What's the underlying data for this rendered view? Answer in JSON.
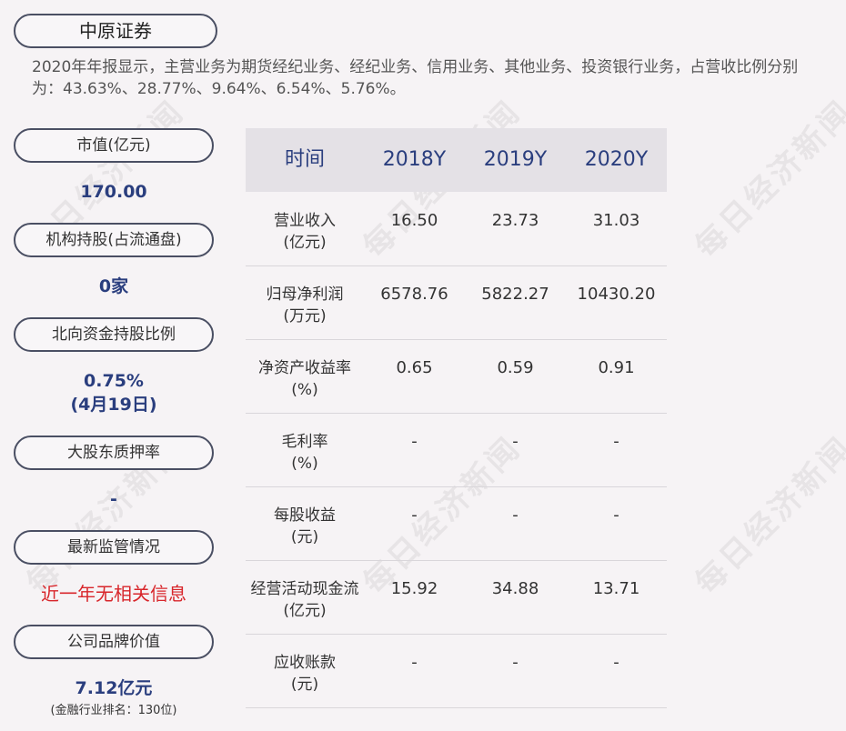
{
  "company": "中原证券",
  "intro": "2020年年报显示，主营业务为期货经纪业务、经纪业务、信用业务、其他业务、投资银行业务，占营收比例分别为：43.63%、28.77%、9.64%、6.54%、5.76%。",
  "sidebar": {
    "market_cap_label": "市值(亿元)",
    "market_cap_value": "170.00",
    "institution_label": "机构持股(占流通盘)",
    "institution_value": "0家",
    "northbound_label": "北向资金持股比例",
    "northbound_value": "0.75%",
    "northbound_date": "(4月19日)",
    "pledge_label": "大股东质押率",
    "pledge_value": "-",
    "regulation_label": "最新监管情况",
    "regulation_value": "近一年无相关信息",
    "brand_label": "公司品牌价值",
    "brand_value": "7.12亿元",
    "brand_rank": "(金融行业排名：130位)"
  },
  "table": {
    "header": [
      "时间",
      "2018Y",
      "2019Y",
      "2020Y"
    ],
    "rows": [
      {
        "label1": "营业收入",
        "label2": "(亿元)",
        "v2018": "16.50",
        "v2019": "23.73",
        "v2020": "31.03"
      },
      {
        "label1": "归母净利润",
        "label2": "(万元)",
        "v2018": "6578.76",
        "v2019": "5822.27",
        "v2020": "10430.20"
      },
      {
        "label1": "净资产收益率",
        "label2": "(%)",
        "v2018": "0.65",
        "v2019": "0.59",
        "v2020": "0.91"
      },
      {
        "label1": "毛利率",
        "label2": "(%)",
        "v2018": "-",
        "v2019": "-",
        "v2020": "-"
      },
      {
        "label1": "每股收益",
        "label2": "(元)",
        "v2018": "-",
        "v2019": "-",
        "v2020": "-"
      },
      {
        "label1": "经营活动现金流",
        "label2": "(亿元)",
        "v2018": "15.92",
        "v2019": "34.88",
        "v2020": "13.71"
      },
      {
        "label1": "应收账款",
        "label2": "(元)",
        "v2018": "-",
        "v2019": "-",
        "v2020": "-"
      }
    ]
  },
  "watermark": "每日经济新闻"
}
